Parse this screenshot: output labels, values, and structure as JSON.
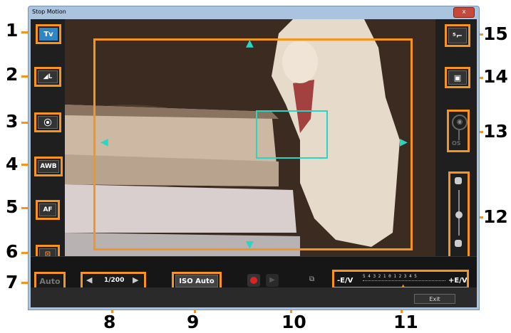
{
  "window": {
    "title": "Stop Motion",
    "close_glyph": "x"
  },
  "left_controls": {
    "shooting_mode": "Tv",
    "image_quality_icon": "image-quality-icon",
    "metering_icon": "metering-icon",
    "white_balance": "AWB",
    "focus_mode": "AF",
    "af_frame_icon": "af-frame-icon"
  },
  "bottom_controls": {
    "auto_button": "Auto",
    "shutter_speed": "1/200",
    "iso": "ISO Auto",
    "exposure_minus": "-E/V",
    "exposure_plus": "+E/V",
    "exposure_scale": "5 4 3 2 1 0 1 2 3 4 5",
    "exit_button": "Exit"
  },
  "right_controls": {
    "drive_mode_icon": "self-timer-icon",
    "shooting_icon": "portrait-icon",
    "camera_icon": "camera-icon",
    "camera_sub": "OS"
  },
  "callouts": [
    "1",
    "2",
    "3",
    "4",
    "5",
    "6",
    "7",
    "8",
    "9",
    "10",
    "11",
    "12",
    "13",
    "14",
    "15"
  ],
  "colors": {
    "highlight": "#f7941d",
    "af_frame": "#2bd6c0",
    "mode_button": "#2f86c6"
  }
}
